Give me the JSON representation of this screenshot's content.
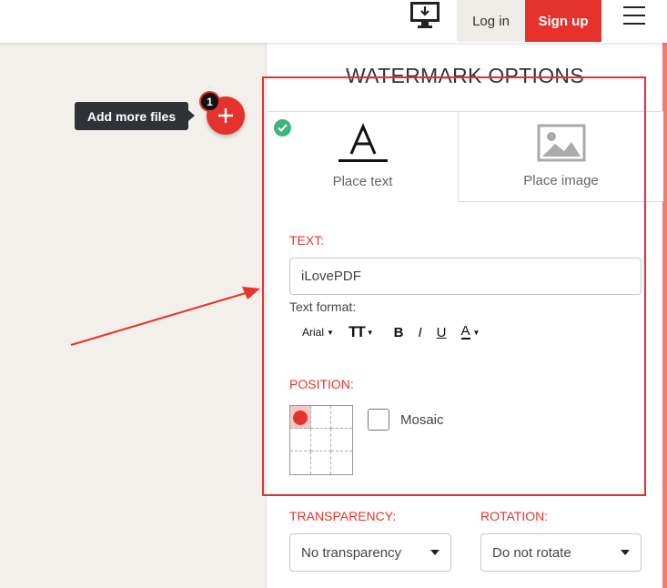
{
  "header": {
    "download_icon": "desktop-download-icon",
    "login_label": "Log in",
    "signup_label": "Sign up",
    "menu_icon": "hamburger-menu-icon"
  },
  "left": {
    "tooltip": "Add more files",
    "badge_count": "1",
    "add_icon": "plus-icon"
  },
  "options": {
    "title": "WATERMARK OPTIONS",
    "tabs": [
      {
        "label": "Place text",
        "icon": "text-a-icon",
        "selected": true
      },
      {
        "label": "Place image",
        "icon": "image-icon",
        "selected": false
      }
    ],
    "text_label": "TEXT:",
    "text_value": "iLovePDF",
    "format_label": "Text format:",
    "font_name": "Arial",
    "size_label": "TT",
    "bold": "B",
    "italic": "I",
    "underline": "U",
    "color": "A",
    "position_label": "POSITION:",
    "position_selected": "top-left",
    "mosaic_label": "Mosaic",
    "mosaic_checked": false,
    "transparency_label": "TRANSPARENCY:",
    "transparency_value": "No transparency",
    "rotation_label": "ROTATION:",
    "rotation_value": "Do not rotate"
  },
  "colors": {
    "accent": "#e5322d",
    "success": "#3fb57a",
    "tooltip_bg": "#2f3237",
    "left_bg": "#f3f0ec"
  }
}
